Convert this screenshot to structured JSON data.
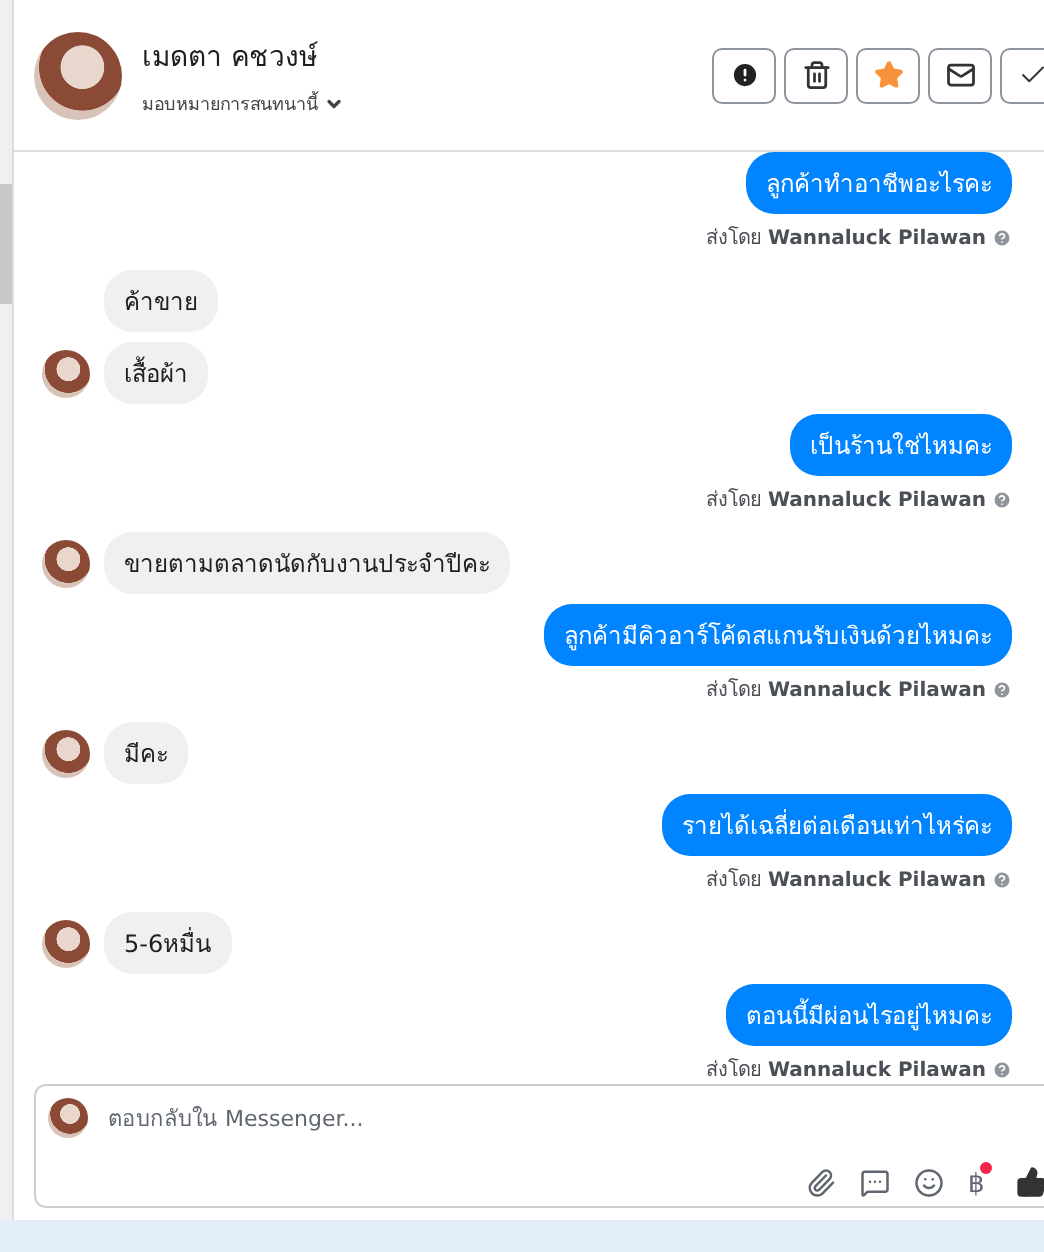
{
  "header": {
    "name": "เมดตา คชวงษ์",
    "assign_label": "มอบหมายการสนทนานี้",
    "starred": true,
    "actions": [
      {
        "kind": "alert"
      },
      {
        "kind": "trash"
      },
      {
        "kind": "star"
      },
      {
        "kind": "mail"
      },
      {
        "kind": "check"
      }
    ]
  },
  "messages": [
    {
      "kind": "outgoing",
      "text": "ลูกค้าทำอาชีพอะไรคะ",
      "sender": "ส่งโดย **Wannaluck Pilawan**"
    },
    {
      "kind": "incoming",
      "text": "ค้าขาย",
      "avatar": false
    },
    {
      "kind": "incoming",
      "text": "เสื้อผ้า",
      "avatar": true
    },
    {
      "kind": "outgoing",
      "text": "เป็นร้านใช่ไหมคะ",
      "sender": "ส่งโดย **Wannaluck Pilawan**"
    },
    {
      "kind": "incoming",
      "text": "ขายตามตลาดนัดกับงานประจำปีคะ",
      "avatar": true
    },
    {
      "kind": "outgoing",
      "text": "ลูกค้ามีคิวอาร์โค้ดสแกนรับเงินด้วยไหมคะ",
      "sender": "ส่งโดย **Wannaluck Pilawan**"
    },
    {
      "kind": "incoming",
      "text": "มีคะ",
      "avatar": true
    },
    {
      "kind": "outgoing",
      "text": "รายได้เฉลี่ยต่อเดือนเท่าไหร่คะ",
      "sender": "ส่งโดย **Wannaluck Pilawan**"
    },
    {
      "kind": "incoming",
      "text": "5-6หมื่น",
      "avatar": true
    },
    {
      "kind": "outgoing",
      "text": "ตอนนี้มีผ่อนไรอยู่ไหมคะ",
      "sender": "ส่งโดย **Wannaluck Pilawan**"
    }
  ],
  "composer": {
    "placeholder": "ตอบกลับใน Messenger...",
    "currency": "฿",
    "payment_badge": true
  }
}
